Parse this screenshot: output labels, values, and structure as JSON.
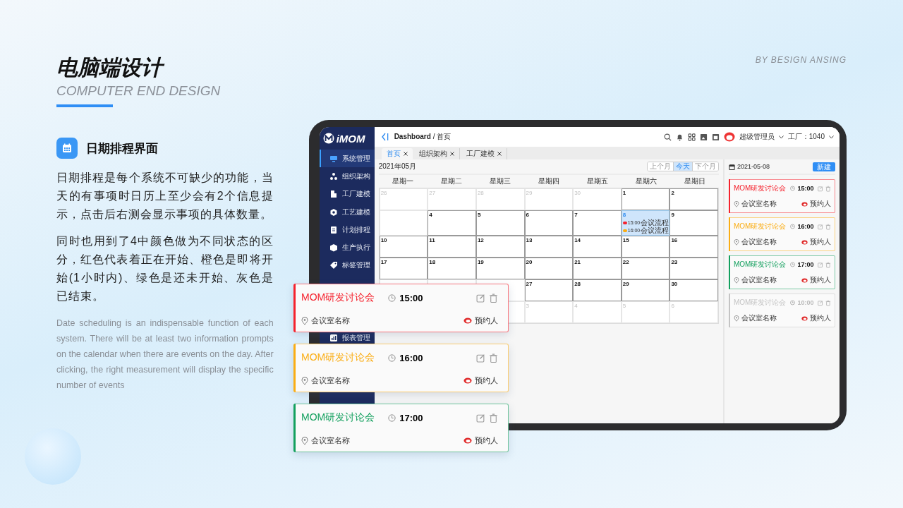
{
  "header": {
    "title": "电脑端设计",
    "subtitle": "COMPUTER END DESIGN",
    "byline": "BY BESIGN ANSING"
  },
  "section": {
    "heading": "日期排程界面",
    "paragraphs": [
      "日期排程是每个系统不可缺少的功能，当天的有事项时日历上至少会有2个信息提示，点击后右测会显示事项的具体数量。",
      "同时也用到了4中颜色做为不同状态的区分，红色代表着正在开始、橙色是即将开始(1小时内)、绿色是还未开始、灰色是已结束。"
    ],
    "english": "Date scheduling is an indispensable function of each system. There will be at least two information prompts on the calendar when there are events on the day. After clicking, the right measurement will display the specific number of events"
  },
  "app": {
    "logo": "iMOM",
    "sidebar": {
      "items": [
        {
          "label": "系统管理",
          "selected": true
        },
        {
          "label": "组织架构",
          "selected": false
        },
        {
          "label": "工厂建模",
          "selected": false
        },
        {
          "label": "工艺建模",
          "selected": false
        },
        {
          "label": "计划排程",
          "selected": false
        },
        {
          "label": "生产执行",
          "selected": false
        },
        {
          "label": "标签管理",
          "selected": false
        },
        {
          "label": "报表管理",
          "selected": false
        }
      ]
    },
    "breadcrumb": {
      "root": "Dashboard",
      "separator": "/",
      "current": "首页"
    },
    "user": "超级管理员",
    "factory": "工厂：1040",
    "tabs": [
      {
        "label": "首页",
        "selected": true
      },
      {
        "label": "组织架构",
        "selected": false
      },
      {
        "label": "工厂建模",
        "selected": false
      }
    ],
    "calendar": {
      "month": "2021年05月",
      "nav": [
        {
          "label": "上个月",
          "selected": false
        },
        {
          "label": "今天",
          "selected": true
        },
        {
          "label": "下个月",
          "selected": false
        }
      ],
      "weekdays": [
        "星期一",
        "星期二",
        "星期三",
        "星期四",
        "星期五",
        "星期六",
        "星期日"
      ],
      "weeks": [
        [
          {
            "kind": "day",
            "day": "26",
            "muted": true
          },
          {
            "kind": "day",
            "day": "27",
            "muted": true
          },
          {
            "kind": "day",
            "day": "28",
            "muted": true
          },
          {
            "kind": "day",
            "day": "29",
            "muted": true
          },
          {
            "kind": "day",
            "day": "30",
            "muted": true
          },
          {
            "kind": "day",
            "day": "1",
            "muted": false
          },
          {
            "kind": "day",
            "day": "2",
            "muted": false
          }
        ],
        [
          {
            "kind": "blank"
          },
          {
            "kind": "day",
            "day": "4",
            "muted": false
          },
          {
            "kind": "day",
            "day": "5",
            "muted": false
          },
          {
            "kind": "day",
            "day": "6",
            "muted": false
          },
          {
            "kind": "day",
            "day": "7",
            "muted": false
          },
          {
            "kind": "day",
            "day": "8",
            "muted": false,
            "selected": true,
            "events": [
              {
                "time": "15:00",
                "name": "会议流程",
                "color": "#f5222d"
              },
              {
                "time": "16:00",
                "name": "会议流程",
                "color": "#faad14"
              }
            ]
          },
          {
            "kind": "day",
            "day": "9",
            "muted": false
          }
        ],
        [
          {
            "kind": "day",
            "day": "10",
            "muted": false
          },
          {
            "kind": "day",
            "day": "11",
            "muted": false
          },
          {
            "kind": "day",
            "day": "12",
            "muted": false
          },
          {
            "kind": "day",
            "day": "13",
            "muted": false
          },
          {
            "kind": "day",
            "day": "14",
            "muted": false
          },
          {
            "kind": "day",
            "day": "15",
            "muted": false
          },
          {
            "kind": "day",
            "day": "16",
            "muted": false
          }
        ],
        [
          {
            "kind": "day",
            "day": "17",
            "muted": false
          },
          {
            "kind": "day",
            "day": "18",
            "muted": false
          },
          {
            "kind": "day",
            "day": "19",
            "muted": false
          },
          {
            "kind": "day",
            "day": "20",
            "muted": false
          },
          {
            "kind": "day",
            "day": "21",
            "muted": false
          },
          {
            "kind": "day",
            "day": "22",
            "muted": false
          },
          {
            "kind": "day",
            "day": "23",
            "muted": false
          }
        ],
        [
          {
            "kind": "blank"
          },
          {
            "kind": "blank"
          },
          {
            "kind": "blank"
          },
          {
            "kind": "day",
            "day": "27",
            "muted": false
          },
          {
            "kind": "day",
            "day": "28",
            "muted": false
          },
          {
            "kind": "day",
            "day": "29",
            "muted": false
          },
          {
            "kind": "day",
            "day": "30",
            "muted": false
          }
        ],
        [
          {
            "kind": "blank"
          },
          {
            "kind": "blank"
          },
          {
            "kind": "blank"
          },
          {
            "kind": "day",
            "day": "3",
            "muted": true
          },
          {
            "kind": "day",
            "day": "4",
            "muted": true
          },
          {
            "kind": "day",
            "day": "5",
            "muted": true
          },
          {
            "kind": "day",
            "day": "6",
            "muted": true
          }
        ]
      ]
    },
    "panel": {
      "date": "2021-05-08",
      "new_button": "新建",
      "events": [
        {
          "title": "MOM研发讨论会",
          "time": "15:00",
          "room": "会议室名称",
          "person": "预约人",
          "color": "#f5222d",
          "ended": false
        },
        {
          "title": "MOM研发讨论会",
          "time": "16:00",
          "room": "会议室名称",
          "person": "预约人",
          "color": "#faad14",
          "ended": false
        },
        {
          "title": "MOM研发讨论会",
          "time": "17:00",
          "room": "会议室名称",
          "person": "预约人",
          "color": "#13a05e",
          "ended": false
        },
        {
          "title": "MOM研发讨论会",
          "time": "10:00",
          "room": "会议室名称",
          "person": "预约人",
          "color": "#c4c4c4",
          "ended": true
        }
      ]
    }
  },
  "floating_cards": [
    {
      "title": "MOM研发讨论会",
      "time": "15:00",
      "room": "会议室名称",
      "person": "预约人",
      "color": "#f5222d"
    },
    {
      "title": "MOM研发讨论会",
      "time": "16:00",
      "room": "会议室名称",
      "person": "预约人",
      "color": "#faad14"
    },
    {
      "title": "MOM研发讨论会",
      "time": "17:00",
      "room": "会议室名称",
      "person": "预约人",
      "color": "#13a05e"
    }
  ]
}
